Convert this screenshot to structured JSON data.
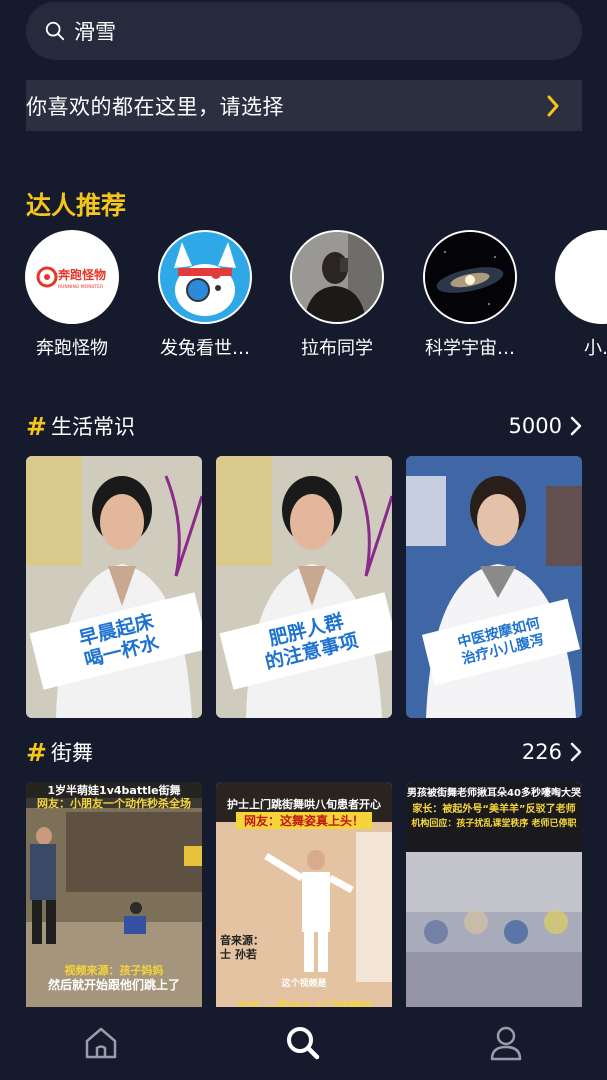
{
  "search": {
    "value": "滑雪"
  },
  "banner": {
    "text": "你喜欢的都在这里，请选择"
  },
  "creators_section": {
    "title": "达人推荐"
  },
  "creators": [
    {
      "name": "奔跑怪物",
      "logo_text": "奔跑怪物",
      "logo_sub": "RUNNING MONSTER"
    },
    {
      "name": "发兔看世…"
    },
    {
      "name": "拉布同学"
    },
    {
      "name": "科学宇宙…"
    },
    {
      "name": "小…"
    }
  ],
  "categories": [
    {
      "title": "生活常识",
      "count": "5000",
      "videos": [
        {
          "caption_lines": [
            "早晨起床",
            "喝一杯水"
          ]
        },
        {
          "caption_lines": [
            "肥胖人群",
            "的注意事项"
          ]
        },
        {
          "caption_lines": [
            "中医按摩如何",
            "治疗小儿腹泻"
          ]
        }
      ]
    },
    {
      "title": "街舞",
      "count": "226",
      "videos": [
        {
          "top_lines": [
            "1岁半萌娃1v4battle街舞",
            "网友：小朋友一个动作秒杀全场"
          ],
          "bottom_lines": [
            "视频来源：孩子妈妈",
            "然后就开始跟他们跳上了"
          ]
        },
        {
          "top_lines": [
            "护士上门跳街舞哄八旬患者开心",
            "网友：这舞姿真上头！"
          ],
          "bottom_lines": [
            "音来源：",
            "士 孙若",
            "这个视频是",
            "北京 一男护士上门护理时"
          ]
        },
        {
          "top_lines": [
            "男孩被街舞老师揪耳朵40多秒嚎啕大哭",
            "家长：被起外号“美羊羊”反驳了老师",
            "机构回应：孩子扰乱课堂秩序 老师已停职"
          ]
        }
      ]
    }
  ],
  "nav": {
    "items": [
      "home-icon",
      "search-icon",
      "profile-icon"
    ],
    "active": "search-icon"
  },
  "colors": {
    "accent": "#f5c518",
    "background": "#161a2d",
    "surface": "#262a3d",
    "caption_blue": "#1e73d0"
  }
}
